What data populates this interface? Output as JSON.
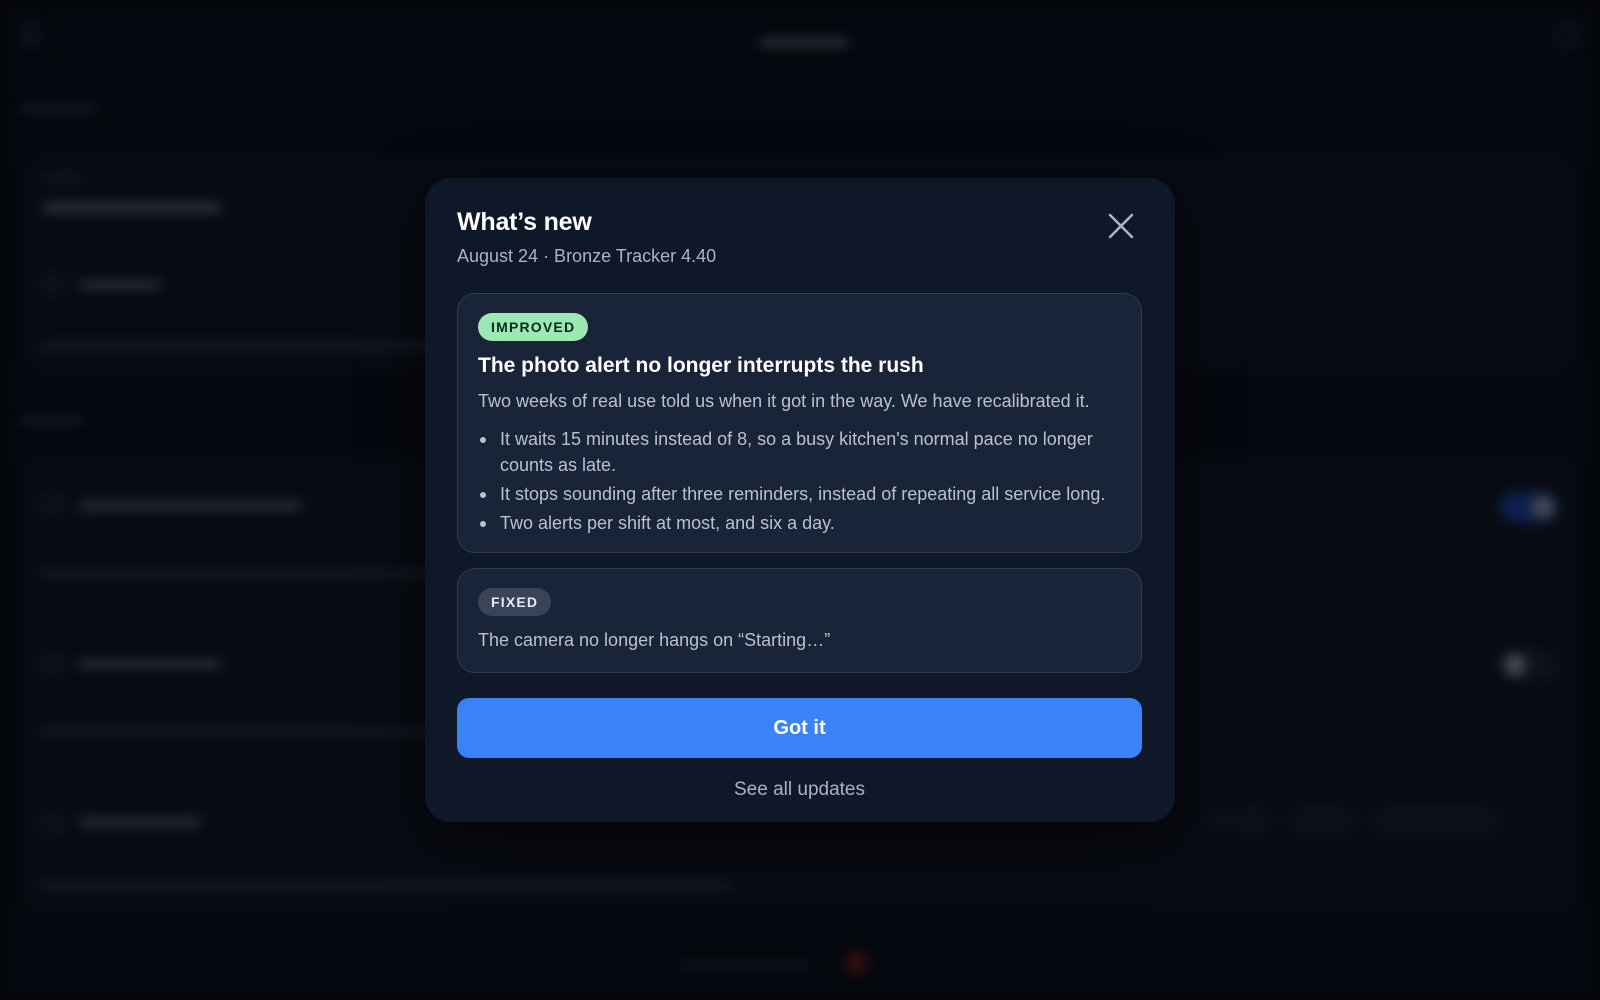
{
  "modal": {
    "title": "What’s new",
    "subtitle": "August 24 · Bronze Tracker 4.40",
    "close_icon": "close-icon",
    "entries": [
      {
        "badge": "IMPROVED",
        "badge_color": "#9be8b4",
        "heading": "The photo alert no longer interrupts the rush",
        "description": "Two weeks of real use told us when it got in the way. We have recalibrated it.",
        "bullets": [
          "It waits 15 minutes instead of 8, so a busy kitchen's normal pace no longer counts as late.",
          "It stops sounding after three reminders, instead of repeating all service long.",
          "Two alerts per shift at most, and six a day."
        ]
      },
      {
        "badge": "FIXED",
        "badge_color": "#3a4458",
        "description": "The camera no longer hangs on “Starting…”"
      }
    ],
    "primary_button": "Got it",
    "primary_color": "#3b82f6",
    "secondary_link": "See all updates"
  }
}
